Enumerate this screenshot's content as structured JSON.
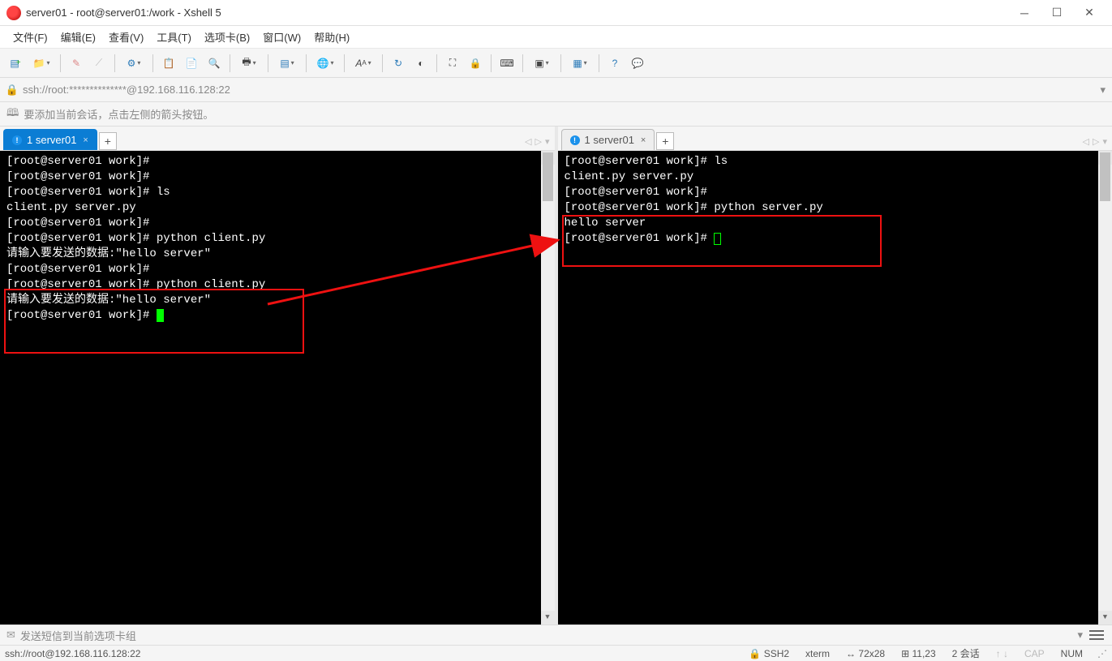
{
  "window": {
    "title": "server01 - root@server01:/work - Xshell 5"
  },
  "menu": {
    "file": "文件(F)",
    "edit": "编辑(E)",
    "view": "查看(V)",
    "tools": "工具(T)",
    "tab": "选项卡(B)",
    "window": "窗口(W)",
    "help": "帮助(H)"
  },
  "address": "ssh://root:**************@192.168.116.128:22",
  "tip": "要添加当前会话，点击左侧的箭头按钮。",
  "tabs": {
    "left": {
      "label": "1 server01"
    },
    "right": {
      "label": "1 server01"
    },
    "new": "+"
  },
  "term_left": {
    "l1": "[root@server01 work]#",
    "l2": "[root@server01 work]#",
    "l3": "[root@server01 work]# ls",
    "l4": "client.py  server.py",
    "l5": "[root@server01 work]#",
    "l6": "[root@server01 work]# python client.py",
    "l7": "请输入要发送的数据:\"hello server\"",
    "l8": "[root@server01 work]#",
    "l9": "[root@server01 work]# python client.py",
    "l10": "请输入要发送的数据:\"hello server\"",
    "l11": "[root@server01 work]# "
  },
  "term_right": {
    "l1": "[root@server01 work]# ls",
    "l2": "client.py  server.py",
    "l3": "[root@server01 work]#",
    "l4": "[root@server01 work]# python server.py",
    "l5": "hello server",
    "l6": "[root@server01 work]# "
  },
  "sendbar": {
    "placeholder": "发送短信到当前选项卡组"
  },
  "status": {
    "left": "ssh://root@192.168.116.128:22",
    "ssh": "SSH2",
    "term": "xterm",
    "size": "72x28",
    "pos": "11,23",
    "sessions": "2 会话",
    "cap": "CAP",
    "num": "NUM"
  }
}
